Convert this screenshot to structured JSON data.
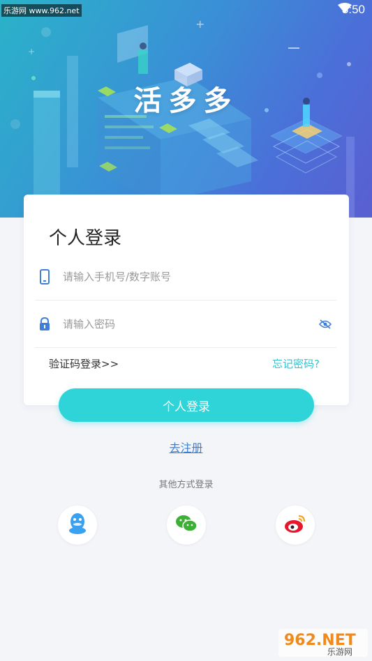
{
  "watermark": {
    "top_left": "乐游网 www.962.net",
    "bottom_right_logo": "962.NET",
    "bottom_right_sub": "乐游网"
  },
  "status_bar": {
    "time": "3:50",
    "wifi_icon": "wifi-icon",
    "battery_icon": "battery-icon"
  },
  "header": {
    "app_title": "活多多"
  },
  "login_card": {
    "title": "个人登录",
    "phone": {
      "icon": "phone-icon",
      "placeholder": "请输入手机号/数字账号",
      "value": ""
    },
    "password": {
      "icon": "lock-icon",
      "placeholder": "请输入密码",
      "value": "",
      "toggle_icon": "eye-icon"
    },
    "code_login_link": "验证码登录>>",
    "forgot_link": "忘记密码?"
  },
  "login_button": "个人登录",
  "register_link": "去注册",
  "other_methods_label": "其他方式登录",
  "social": [
    {
      "name": "qq",
      "icon": "qq-icon",
      "color": "#3aa0f0"
    },
    {
      "name": "wechat",
      "icon": "wechat-icon",
      "color": "#3cb034"
    },
    {
      "name": "weibo",
      "icon": "weibo-icon",
      "color": "#e6162d"
    }
  ],
  "colors": {
    "accent": "#2ed4d8",
    "link": "#3a7fd6",
    "forgot": "#2ec6d3",
    "icon_blue": "#3d7fd9"
  }
}
